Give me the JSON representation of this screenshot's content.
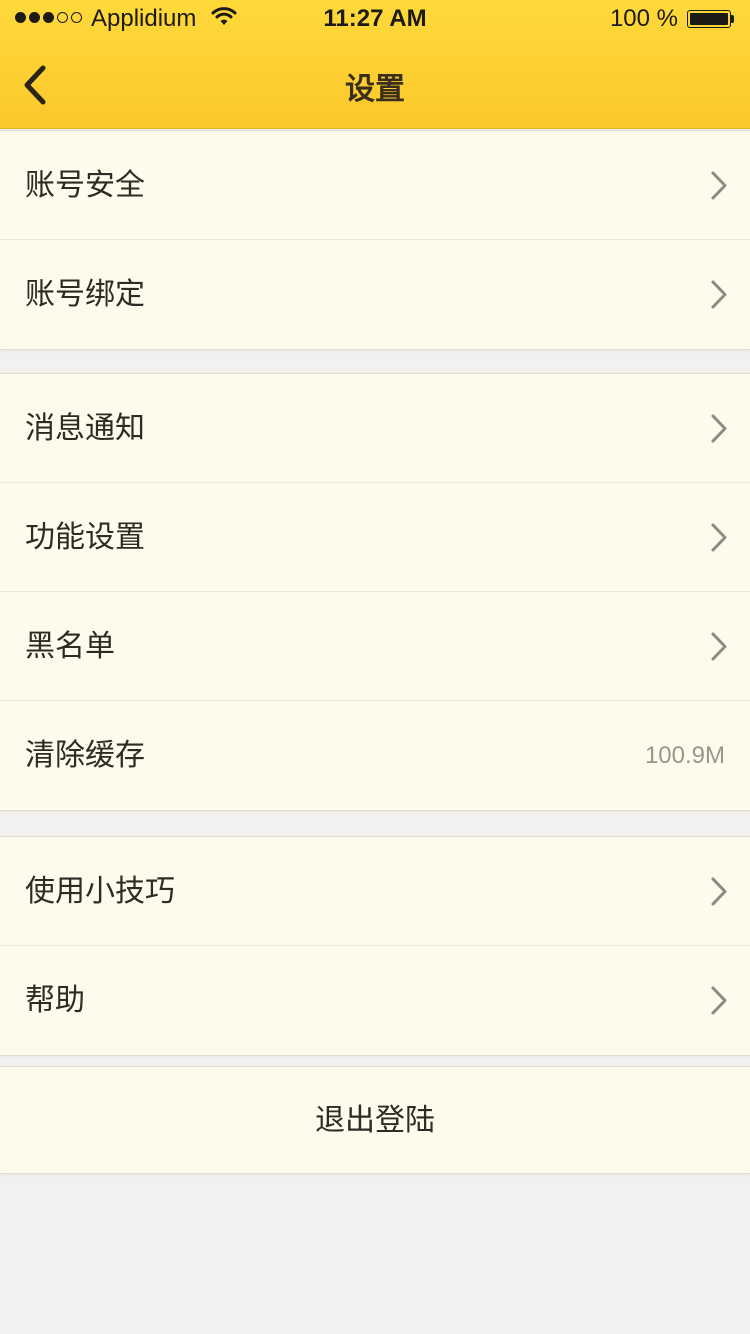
{
  "status_bar": {
    "carrier": "Applidium",
    "time": "11:27 AM",
    "battery": "100 %",
    "signal_filled_dots": 3,
    "signal_total_dots": 5,
    "battery_level": 1.0
  },
  "nav": {
    "title": "设置",
    "back_icon": "chevron-left-icon"
  },
  "groups": [
    {
      "items": [
        {
          "label": "账号安全",
          "icon": "chevron-right-icon"
        },
        {
          "label": "账号绑定",
          "icon": "chevron-right-icon"
        }
      ]
    },
    {
      "items": [
        {
          "label": "消息通知",
          "icon": "chevron-right-icon"
        },
        {
          "label": "功能设置",
          "icon": "chevron-right-icon"
        },
        {
          "label": "黑名单",
          "icon": "chevron-right-icon"
        },
        {
          "label": "清除缓存",
          "value": "100.9M"
        }
      ]
    },
    {
      "items": [
        {
          "label": "使用小技巧",
          "icon": "chevron-right-icon"
        },
        {
          "label": "帮助",
          "icon": "chevron-right-icon"
        }
      ]
    }
  ],
  "logout": {
    "label": "退出登陆"
  },
  "colors": {
    "header": "#fcc82c",
    "row_background": "#fefaec",
    "page_background": "#f2f1ef",
    "text": "#2e2a24",
    "secondary_text": "#9a968c"
  }
}
